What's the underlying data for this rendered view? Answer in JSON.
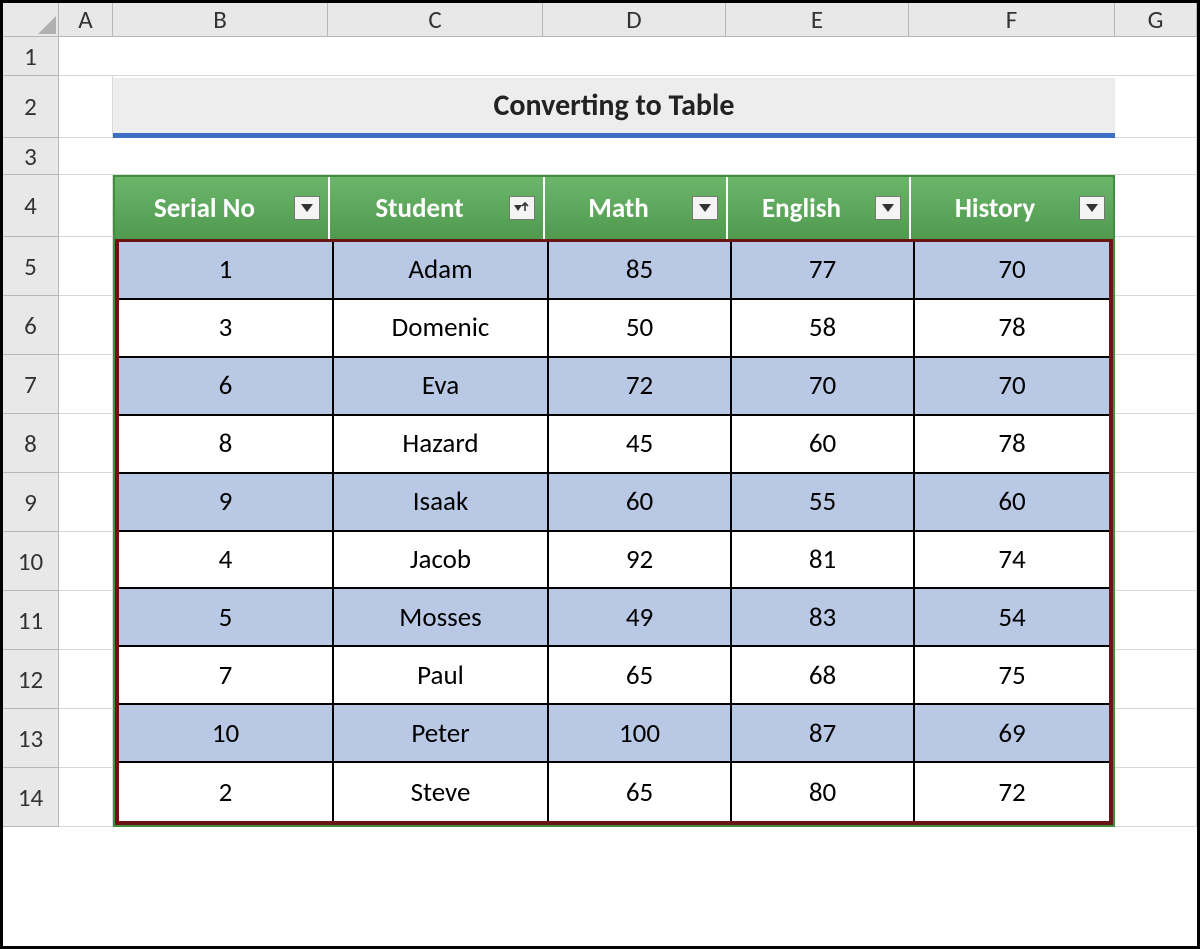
{
  "columns": [
    "A",
    "B",
    "C",
    "D",
    "E",
    "F",
    "G"
  ],
  "rowLabels": [
    "1",
    "2",
    "3",
    "4",
    "5",
    "6",
    "7",
    "8",
    "9",
    "10",
    "11",
    "12",
    "13",
    "14"
  ],
  "title": "Converting to Table",
  "table": {
    "headers": [
      {
        "label": "Serial No",
        "filter": "dropdown"
      },
      {
        "label": "Student",
        "filter": "sort-asc"
      },
      {
        "label": "Math",
        "filter": "dropdown"
      },
      {
        "label": "English",
        "filter": "dropdown"
      },
      {
        "label": "History",
        "filter": "dropdown"
      }
    ],
    "rows": [
      {
        "serial": "1",
        "student": "Adam",
        "math": "85",
        "english": "77",
        "history": "70"
      },
      {
        "serial": "3",
        "student": "Domenic",
        "math": "50",
        "english": "58",
        "history": "78"
      },
      {
        "serial": "6",
        "student": "Eva",
        "math": "72",
        "english": "70",
        "history": "70"
      },
      {
        "serial": "8",
        "student": "Hazard",
        "math": "45",
        "english": "60",
        "history": "78"
      },
      {
        "serial": "9",
        "student": "Isaak",
        "math": "60",
        "english": "55",
        "history": "60"
      },
      {
        "serial": "4",
        "student": "Jacob",
        "math": "92",
        "english": "81",
        "history": "74"
      },
      {
        "serial": "5",
        "student": "Mosses",
        "math": "49",
        "english": "83",
        "history": "54"
      },
      {
        "serial": "7",
        "student": "Paul",
        "math": "65",
        "english": "68",
        "history": "75"
      },
      {
        "serial": "10",
        "student": "Peter",
        "math": "100",
        "english": "87",
        "history": "69"
      },
      {
        "serial": "2",
        "student": "Steve",
        "math": "65",
        "english": "80",
        "history": "72"
      }
    ]
  }
}
